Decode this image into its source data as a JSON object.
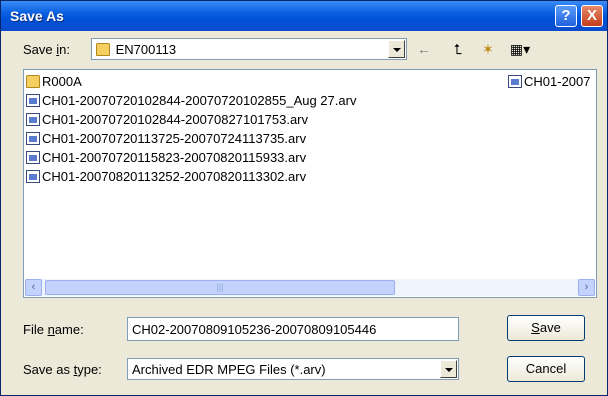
{
  "window": {
    "title": "Save As"
  },
  "titlebar": {
    "help": "?",
    "close": "X"
  },
  "save_in": {
    "label_pre": "Save ",
    "label_key": "i",
    "label_post": "n:",
    "value": "EN700113"
  },
  "files": {
    "folder": "R000A",
    "col2_item": "CH01-2007",
    "items": [
      "CH01-20070720102844-20070720102855_Aug 27.arv",
      "CH01-20070720102844-20070827101753.arv",
      "CH01-20070720113725-20070724113735.arv",
      "CH01-20070720115823-20070820115933.arv",
      "CH01-20070820113252-20070820113302.arv"
    ]
  },
  "filename": {
    "label_pre": "File ",
    "label_key": "n",
    "label_post": "ame:",
    "value": "CH02-20070809105236-20070809105446"
  },
  "filetype": {
    "label_pre": "Save as ",
    "label_key": "t",
    "label_post": "ype:",
    "value": "Archived EDR MPEG Files (*.arv)"
  },
  "buttons": {
    "save_key": "S",
    "save_rest": "ave",
    "cancel": "Cancel"
  },
  "toolbar": {
    "back": "←",
    "up": "⮤",
    "newfolder": "✶",
    "views": "▦▾"
  },
  "scrollbar": {
    "left": "‹",
    "right": "›",
    "grip": "|||"
  }
}
